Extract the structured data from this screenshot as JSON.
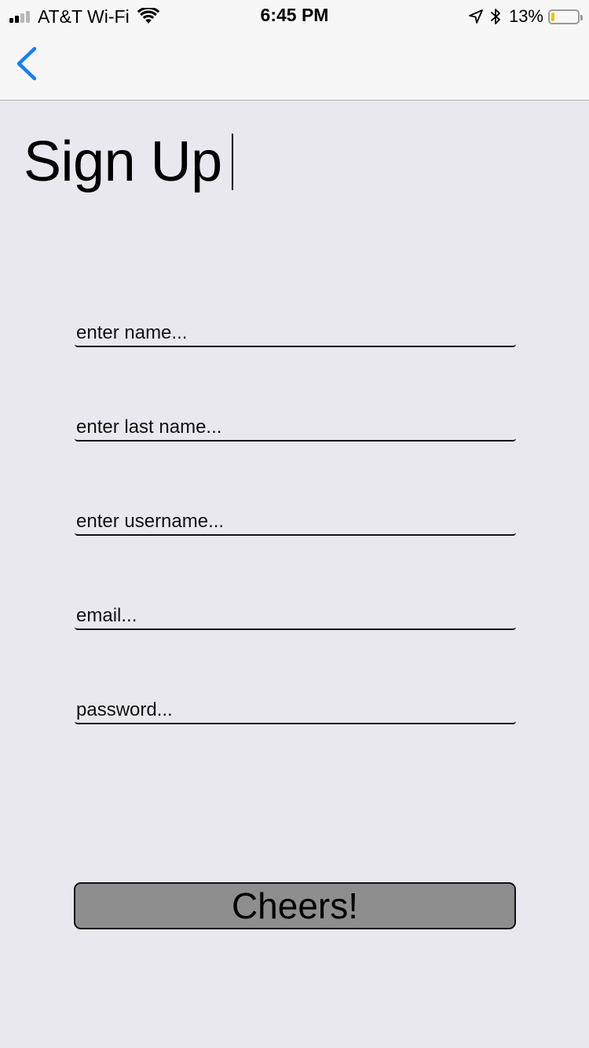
{
  "status_bar": {
    "carrier": "AT&T Wi-Fi",
    "time": "6:45 PM",
    "battery_percent": "13%",
    "battery_level": 0.13,
    "signal_bars_filled": 2,
    "signal_bars_total": 4,
    "battery_color": "#f2c200",
    "icons": [
      "signal-icon",
      "wifi-icon",
      "location-arrow-icon",
      "bluetooth-icon",
      "battery-icon"
    ]
  },
  "nav": {
    "back_icon": "chevron-left-icon",
    "accent_color": "#147efb"
  },
  "page": {
    "title": "Sign Up"
  },
  "form": {
    "fields": [
      {
        "id": "first_name",
        "placeholder": "enter name...",
        "value": ""
      },
      {
        "id": "last_name",
        "placeholder": "enter last name...",
        "value": ""
      },
      {
        "id": "username",
        "placeholder": "enter username...",
        "value": ""
      },
      {
        "id": "email",
        "placeholder": "email...",
        "value": ""
      },
      {
        "id": "password",
        "placeholder": "password...",
        "value": ""
      }
    ],
    "submit_label": "Cheers!"
  }
}
